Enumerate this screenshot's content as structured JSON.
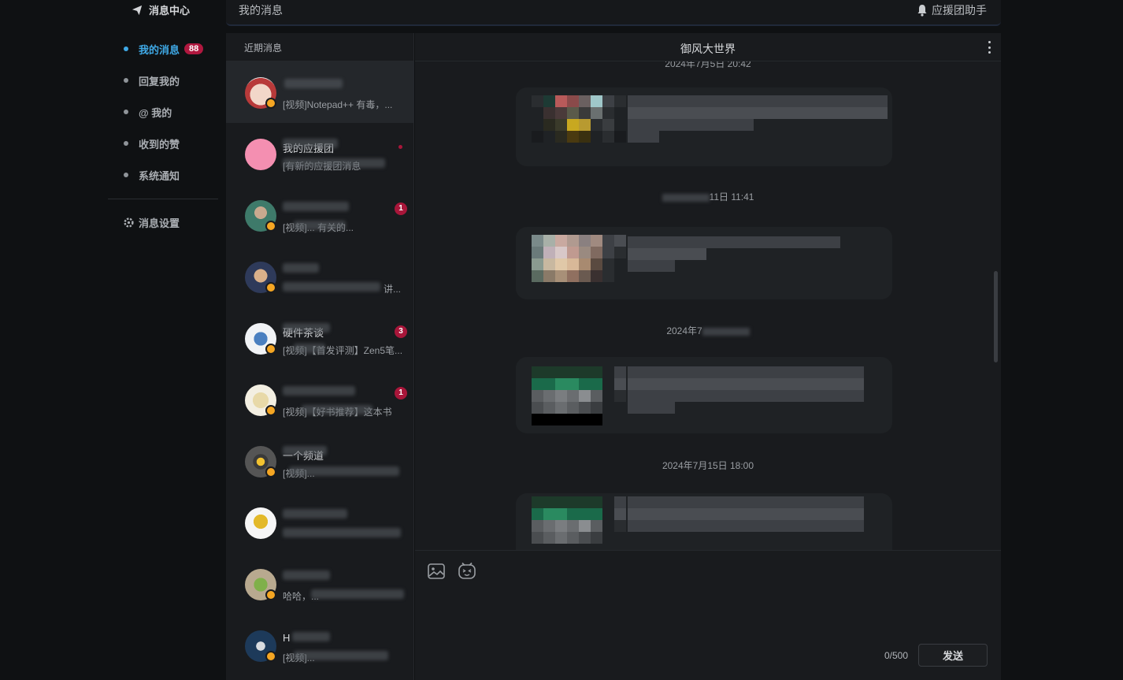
{
  "nav": {
    "title": "消息中心",
    "items": [
      {
        "label": "我的消息",
        "badge": "88"
      },
      {
        "label": "回复我的"
      },
      {
        "label": "@ 我的"
      },
      {
        "label": "收到的赞"
      },
      {
        "label": "系统通知"
      }
    ],
    "settings_label": "消息设置"
  },
  "header": {
    "title": "我的消息",
    "right_label": "应援团助手"
  },
  "conversations": {
    "heading": "近期消息",
    "items": [
      {
        "name": "",
        "preview": "[视频]Notepad++ 有毒，...",
        "unread": ""
      },
      {
        "name": "我的应援团",
        "preview": "[有新的应援团消息",
        "unread": "",
        "dot": true
      },
      {
        "name": "",
        "preview": "[视频]... 有关的...",
        "unread": "1"
      },
      {
        "name": "",
        "preview": "讲...",
        "unread": ""
      },
      {
        "name": "硬件茶谈",
        "preview": "[视频]【首发评测】Zen5笔...",
        "unread": "3"
      },
      {
        "name": "",
        "preview": "[视频]【好书推荐】这本书",
        "unread": "1"
      },
      {
        "name": "一个频道",
        "preview": "[视频]...",
        "unread": ""
      },
      {
        "name": "",
        "preview": "",
        "unread": ""
      },
      {
        "name": "",
        "preview": "哈哈，...",
        "unread": ""
      },
      {
        "name": "H",
        "preview": "[视频]...",
        "unread": ""
      }
    ]
  },
  "chat": {
    "title": "御风大世界",
    "timestamps": [
      "2024年7月5日 20:42",
      "11日 11:41",
      "2024年7",
      "2024年7月15日 18:00"
    ],
    "counter": "0/500",
    "send_label": "发送"
  },
  "icons": {
    "nav_title": "paper-plane-icon",
    "settings": "gear-icon",
    "header_right": "bell-icon",
    "more": "more-vertical-icon",
    "image": "image-icon",
    "emoji": "emoji-icon"
  },
  "colors": {
    "accent": "#3fa9e6",
    "badge": "#b0183f",
    "background": "#0f1113",
    "panel": "#191b1e"
  }
}
